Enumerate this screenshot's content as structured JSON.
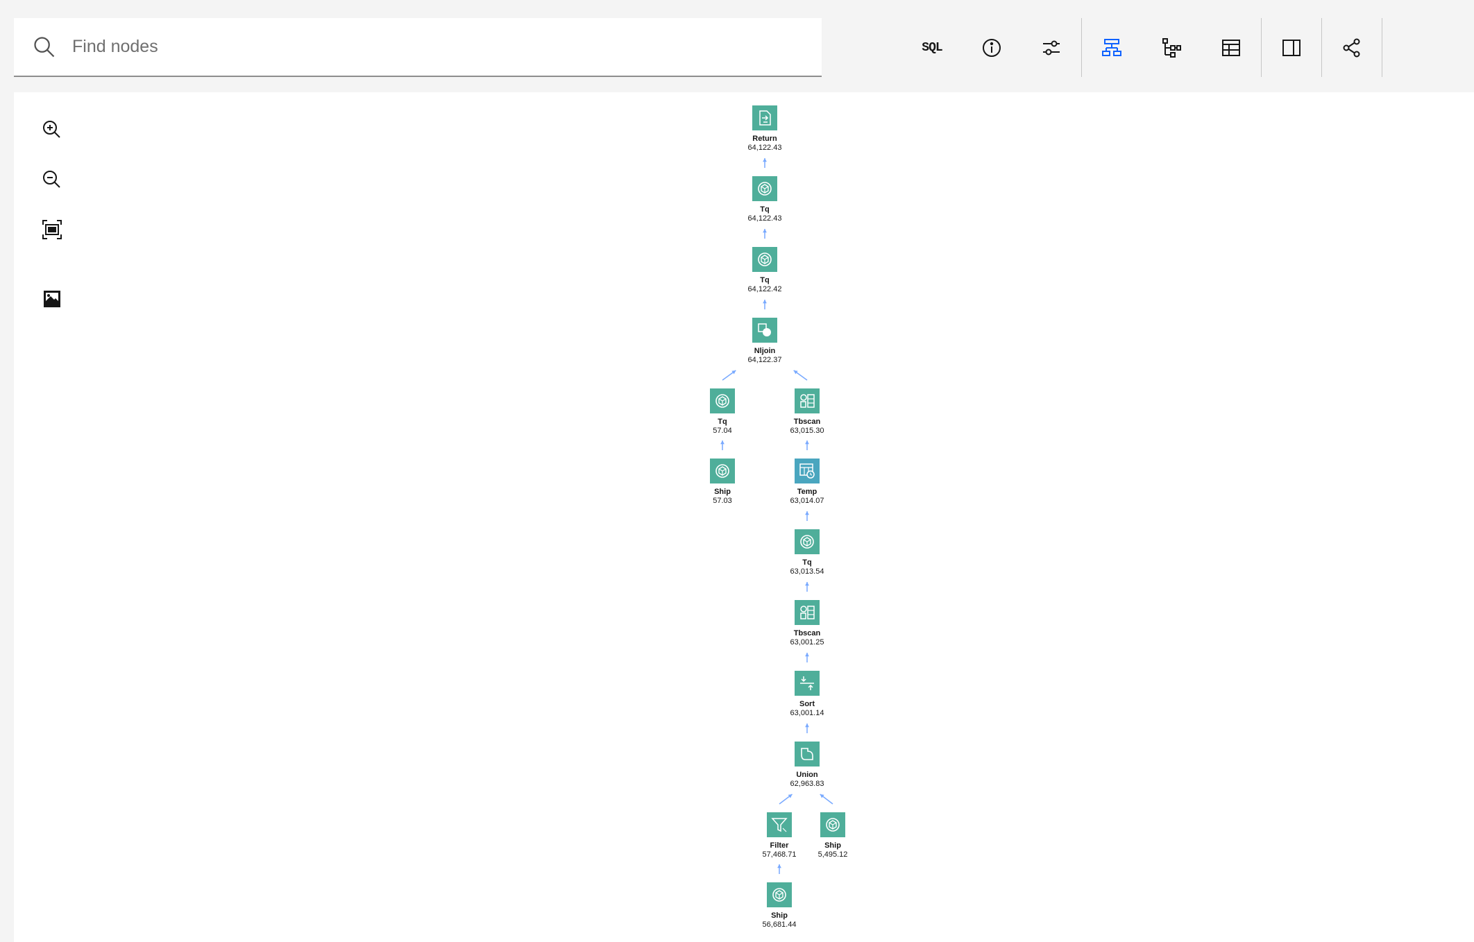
{
  "search": {
    "placeholder": "Find nodes",
    "icon": "search-icon"
  },
  "toolbar": {
    "sql_label": "SQL",
    "buttons": [
      "sql",
      "info",
      "settings",
      "graph-view",
      "tree-view",
      "table-view",
      "side-panel",
      "share"
    ],
    "active": "graph-view",
    "active_color": "#0f62fe"
  },
  "zoom_controls": [
    "zoom-in",
    "zoom-out",
    "fit-to-screen",
    "export-image"
  ],
  "node_colors": {
    "default": "#4fae9a",
    "temp": "#4aa6bf",
    "arrow": "#78a9ff"
  },
  "plan": {
    "nodes": [
      {
        "id": "n0",
        "name": "Return",
        "cost": "64,122.43",
        "icon": "return-icon"
      },
      {
        "id": "n1",
        "name": "Tq",
        "cost": "64,122.43",
        "icon": "tq-icon"
      },
      {
        "id": "n2",
        "name": "Tq",
        "cost": "64,122.42",
        "icon": "tq-icon"
      },
      {
        "id": "n3",
        "name": "Nljoin",
        "cost": "64,122.37",
        "icon": "nljoin-icon"
      },
      {
        "id": "n4",
        "name": "Tq",
        "cost": "57.04",
        "icon": "tq-icon"
      },
      {
        "id": "n5",
        "name": "Ship",
        "cost": "57.03",
        "icon": "ship-icon"
      },
      {
        "id": "n6",
        "name": "Tbscan",
        "cost": "63,015.30",
        "icon": "tbscan-icon"
      },
      {
        "id": "n7",
        "name": "Temp",
        "cost": "63,014.07",
        "icon": "temp-icon"
      },
      {
        "id": "n8",
        "name": "Tq",
        "cost": "63,013.54",
        "icon": "tq-icon"
      },
      {
        "id": "n9",
        "name": "Tbscan",
        "cost": "63,001.25",
        "icon": "tbscan-icon"
      },
      {
        "id": "n10",
        "name": "Sort",
        "cost": "63,001.14",
        "icon": "sort-icon"
      },
      {
        "id": "n11",
        "name": "Union",
        "cost": "62,963.83",
        "icon": "union-icon"
      },
      {
        "id": "n12",
        "name": "Filter",
        "cost": "57,468.71",
        "icon": "filter-icon"
      },
      {
        "id": "n13",
        "name": "Ship",
        "cost": "5,495.12",
        "icon": "ship-icon"
      },
      {
        "id": "n14",
        "name": "Ship",
        "cost": "56,681.44",
        "icon": "ship-icon"
      }
    ]
  }
}
